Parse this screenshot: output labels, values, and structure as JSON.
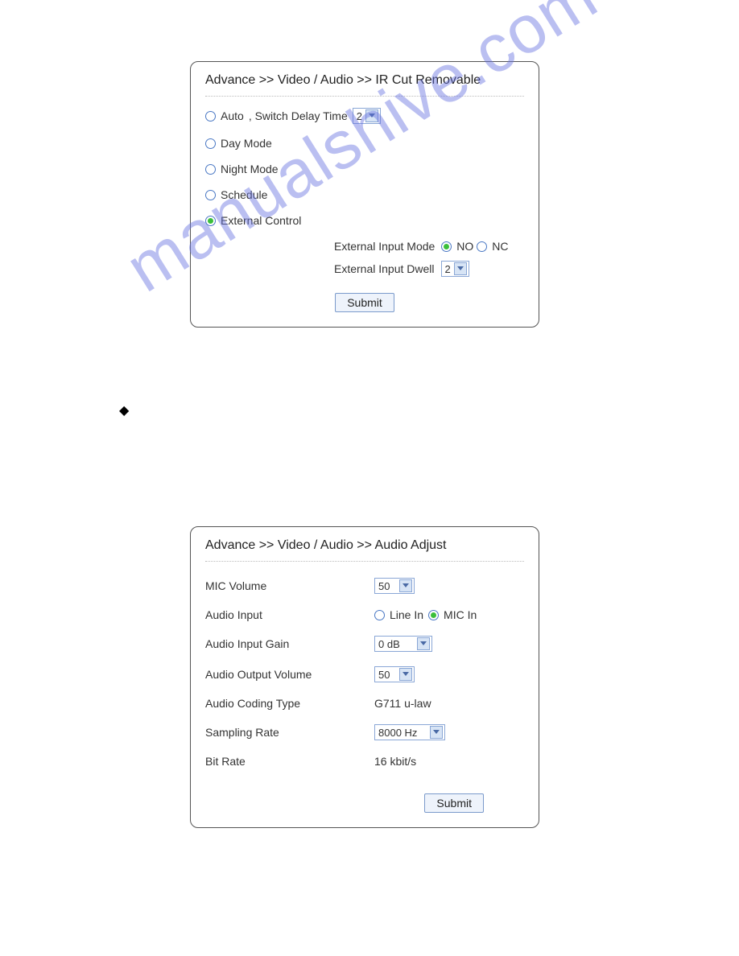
{
  "watermark": "manualshive.com",
  "panel1": {
    "breadcrumb": "Advance >> Video / Audio >> IR Cut Removable",
    "modes": {
      "auto_label": "Auto",
      "switch_delay_label": ", Switch Delay Time",
      "switch_delay_value": "2",
      "day_label": "Day Mode",
      "night_label": "Night Mode",
      "schedule_label": "Schedule",
      "external_label": "External Control"
    },
    "external": {
      "input_mode_label": "External Input Mode",
      "no_label": "NO",
      "nc_label": "NC",
      "dwell_label": "External Input Dwell",
      "dwell_value": "2"
    },
    "submit_label": "Submit"
  },
  "panel2": {
    "breadcrumb": "Advance >> Video / Audio >> Audio Adjust",
    "fields": {
      "mic_volume_label": "MIC Volume",
      "mic_volume_value": "50",
      "audio_input_label": "Audio Input",
      "line_in_label": "Line In",
      "mic_in_label": "MIC In",
      "audio_input_gain_label": "Audio Input Gain",
      "audio_input_gain_value": "0 dB",
      "audio_output_volume_label": "Audio Output Volume",
      "audio_output_volume_value": "50",
      "audio_coding_type_label": "Audio Coding Type",
      "audio_coding_type_value": "G711 u-law",
      "sampling_rate_label": "Sampling Rate",
      "sampling_rate_value": "8000 Hz",
      "bit_rate_label": "Bit Rate",
      "bit_rate_value": "16 kbit/s"
    },
    "submit_label": "Submit"
  }
}
